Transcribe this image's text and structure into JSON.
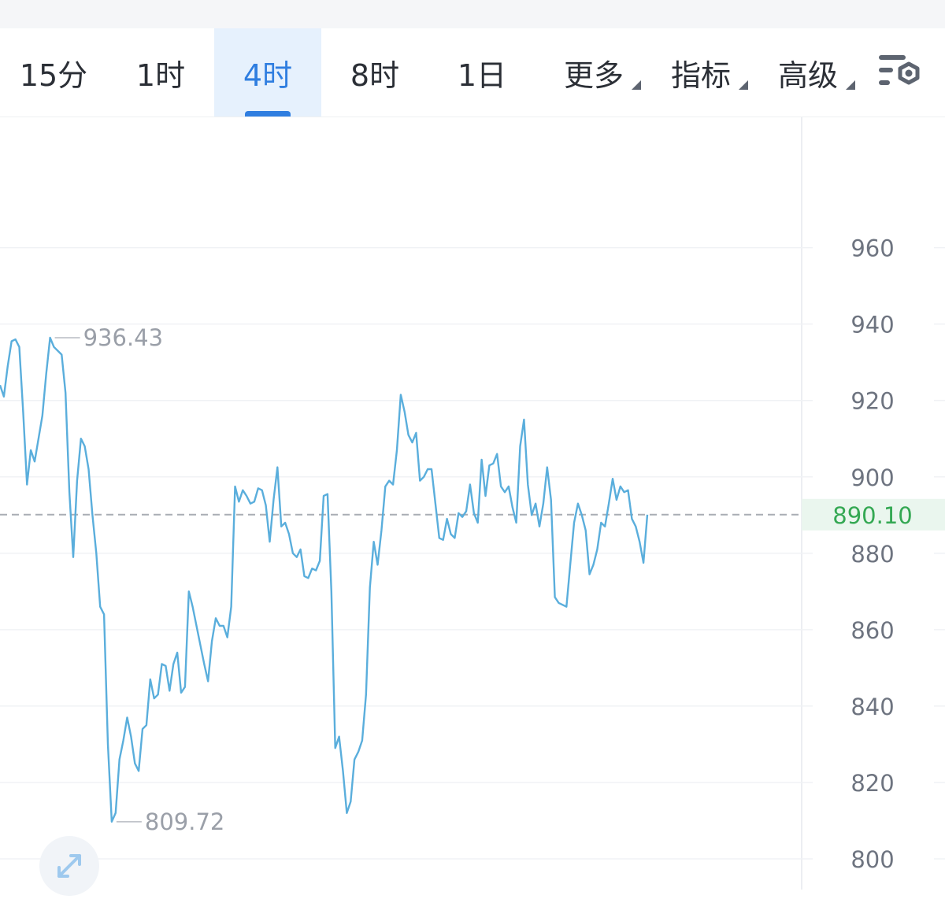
{
  "tabs": [
    {
      "label": "15分",
      "active": false
    },
    {
      "label": "1时",
      "active": false
    },
    {
      "label": "4时",
      "active": true
    },
    {
      "label": "8时",
      "active": false
    },
    {
      "label": "1日",
      "active": false
    },
    {
      "label": "更多",
      "active": false,
      "dropdown": true
    },
    {
      "label": "指标",
      "active": false,
      "dropdown": true
    },
    {
      "label": "高级",
      "active": false,
      "dropdown": true
    }
  ],
  "icons": {
    "settings": "chart-settings-icon",
    "expand": "expand-arrows-icon"
  },
  "colors": {
    "line": "#5aaedc",
    "accent": "#2f7ee0",
    "current_price": "#34a853"
  },
  "chart_data": {
    "type": "line",
    "ylim": [
      800,
      960
    ],
    "yticks": [
      960,
      940,
      920,
      900,
      880,
      860,
      840,
      820,
      800
    ],
    "grid": true,
    "current_price": 890.1,
    "current_price_label": "890.10",
    "max_label": "936.43",
    "min_label": "809.72",
    "series": [
      {
        "values": [
          924.0,
          921.0,
          929.0,
          935.5,
          936.0,
          934.0,
          917.0,
          898.0,
          907.0,
          904.0,
          910.0,
          916.0,
          927.0,
          936.43,
          934.0,
          933.0,
          932.0,
          922.0,
          896.0,
          879.0,
          899.0,
          910.0,
          908.0,
          902.0,
          890.0,
          880.0,
          866.0,
          864.0,
          830.0,
          809.72,
          812.0,
          826.0,
          831.0,
          837.0,
          832.0,
          825.0,
          823.0,
          834.0,
          835.0,
          847.0,
          842.0,
          843.0,
          851.0,
          850.5,
          844.0,
          851.0,
          854.0,
          843.5,
          845.0,
          870.0,
          866.0,
          861.0,
          856.0,
          851.0,
          846.5,
          857.0,
          863.0,
          861.0,
          861.0,
          858.0,
          866.0,
          897.5,
          893.5,
          896.5,
          895.0,
          893.0,
          893.5,
          897.0,
          896.5,
          892.5,
          883.0,
          894.0,
          902.5,
          887.0,
          888.0,
          885.0,
          880.0,
          879.0,
          881.0,
          874.0,
          873.5,
          876.0,
          875.5,
          878.0,
          895.0,
          895.5,
          870.0,
          829.0,
          832.0,
          823.0,
          812.0,
          815.0,
          826.0,
          828.0,
          831.0,
          843.0,
          871.0,
          883.0,
          877.0,
          886.0,
          897.5,
          899.0,
          898.0,
          907.0,
          921.5,
          917.0,
          911.0,
          909.0,
          911.5,
          899.0,
          900.0,
          902.0,
          902.0,
          893.0,
          884.0,
          883.5,
          889.0,
          885.0,
          884.0,
          890.5,
          889.5,
          891.0,
          898.0,
          890.5,
          888.0,
          904.5,
          895.0,
          903.0,
          903.5,
          906.0,
          897.5,
          896.0,
          897.5,
          892.0,
          888.0,
          908.0,
          915.0,
          898.0,
          890.0,
          893.0,
          887.0,
          893.0,
          902.5,
          894.0,
          868.5,
          867.0,
          866.5,
          866.0,
          877.0,
          888.0,
          893.0,
          890.0,
          886.0,
          874.5,
          877.0,
          881.0,
          888.0,
          887.0,
          893.0,
          899.5,
          894.0,
          897.5,
          896.0,
          896.5,
          889.0,
          887.0,
          883.0,
          877.5,
          890.1
        ]
      }
    ]
  }
}
